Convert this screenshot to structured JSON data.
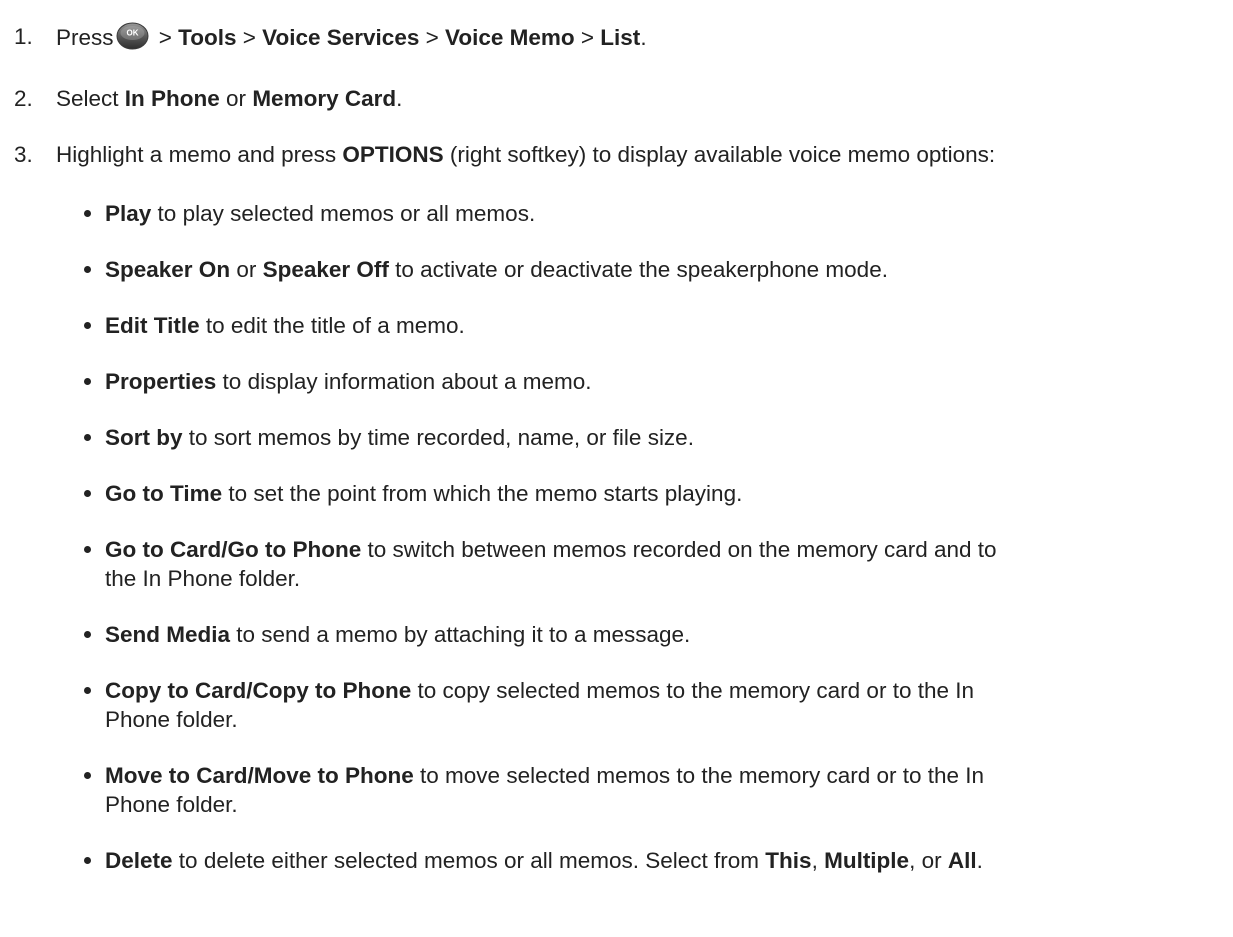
{
  "steps": [
    {
      "number": "1.",
      "press": "Press",
      "ok_icon_label": "OK",
      "sep1": " > ",
      "tools": "Tools",
      "sep2": " > ",
      "voice_services": "Voice Services",
      "sep3": " > ",
      "voice_memo": "Voice Memo",
      "sep4": " > ",
      "list": "List",
      "end": "."
    },
    {
      "number": "2.",
      "select": "Select ",
      "in_phone": "In Phone",
      "or": " or ",
      "memory_card": "Memory Card",
      "end": "."
    },
    {
      "number": "3.",
      "pre": "Highlight a memo and press ",
      "options": "OPTIONS",
      "post": " (right softkey) to display available voice memo options:"
    }
  ],
  "options": [
    {
      "term": "Play",
      "desc": " to play selected memos or all memos."
    },
    {
      "term": "Speaker On",
      "mid": " or ",
      "term2": "Speaker Off",
      "desc": " to activate or deactivate the speakerphone mode."
    },
    {
      "term": "Edit Title",
      "desc": " to edit the title of a memo."
    },
    {
      "term": "Properties",
      "desc": " to display information about a memo."
    },
    {
      "term": "Sort by",
      "desc": " to sort memos by time recorded, name, or file size."
    },
    {
      "term": "Go to Time",
      "desc": " to set the point from which the memo starts playing."
    },
    {
      "term": "Go to Card/Go to Phone",
      "desc": " to switch between memos recorded on the memory card and to",
      "desc2": "the In Phone folder."
    },
    {
      "term": "Send Media",
      "desc": " to send a memo by attaching it to a message."
    },
    {
      "term": "Copy to Card/Copy to Phone",
      "desc": " to copy selected memos to the memory card or to the In",
      "desc2": "Phone folder."
    },
    {
      "term": "Move to Card/Move to Phone",
      "desc": " to move selected memos to the memory card or to the In",
      "desc2": "Phone folder."
    },
    {
      "term": "Delete",
      "desc": " to delete either selected memos or all memos. Select from ",
      "this": "This",
      "c1": ", ",
      "multiple": "Multiple",
      "c2": ", or ",
      "all": "All",
      "end": "."
    }
  ]
}
